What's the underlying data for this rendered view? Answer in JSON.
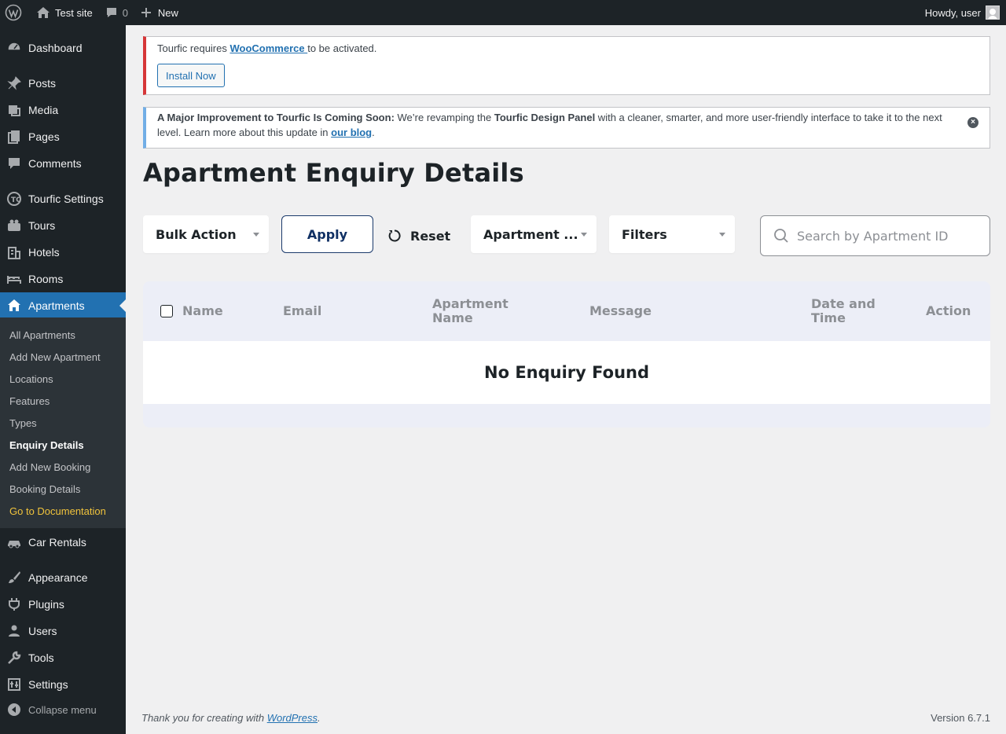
{
  "adminbar": {
    "site_name": "Test site",
    "comments_count": "0",
    "new_label": "New",
    "howdy": "Howdy, user"
  },
  "sidebar": {
    "items": [
      {
        "label": "Dashboard",
        "icon": "dashboard-icon"
      },
      {
        "label": "Posts",
        "icon": "pin-icon"
      },
      {
        "label": "Media",
        "icon": "media-icon"
      },
      {
        "label": "Pages",
        "icon": "pages-icon"
      },
      {
        "label": "Comments",
        "icon": "comment-icon"
      },
      {
        "label": "Tourfic Settings",
        "icon": "tourfic-icon"
      },
      {
        "label": "Tours",
        "icon": "tours-icon"
      },
      {
        "label": "Hotels",
        "icon": "building-icon"
      },
      {
        "label": "Rooms",
        "icon": "bed-icon"
      },
      {
        "label": "Apartments",
        "icon": "home-icon"
      },
      {
        "label": "Car Rentals",
        "icon": "car-icon"
      },
      {
        "label": "Appearance",
        "icon": "brush-icon"
      },
      {
        "label": "Plugins",
        "icon": "plug-icon"
      },
      {
        "label": "Users",
        "icon": "user-icon"
      },
      {
        "label": "Tools",
        "icon": "wrench-icon"
      },
      {
        "label": "Settings",
        "icon": "settings-icon"
      }
    ],
    "submenu": [
      "All Apartments",
      "Add New Apartment",
      "Locations",
      "Features",
      "Types",
      "Enquiry Details",
      "Add New Booking",
      "Booking Details",
      "Go to Documentation"
    ],
    "collapse_label": "Collapse menu"
  },
  "notices": {
    "error": {
      "text_before": "Tourfic requires ",
      "link": "WooCommerce ",
      "text_after": "to be activated.",
      "button": "Install Now"
    },
    "info": {
      "bold1": "A Major Improvement to Tourfic Is Coming Soon:",
      "text1": " We’re revamping the ",
      "bold2": "Tourfic Design Panel",
      "text2": " with a cleaner, smarter, and more user-friendly interface to take it to the next level. Learn more about this update in ",
      "link": "our blog",
      "text3": "."
    }
  },
  "page": {
    "title": "Apartment Enquiry Details"
  },
  "toolbar": {
    "bulk_action": "Bulk Action",
    "apply": "Apply",
    "reset": "Reset",
    "apartment_filter": "Apartment ...",
    "filters": "Filters",
    "search_placeholder": "Search by Apartment ID"
  },
  "table": {
    "headers": {
      "name": "Name",
      "email": "Email",
      "apartment_name_1": "Apartment",
      "apartment_name_2": "Name",
      "message": "Message",
      "date_1": "Date and",
      "date_2": "Time",
      "action": "Action"
    },
    "empty": "No Enquiry Found"
  },
  "footer": {
    "thanks": "Thank you for creating with ",
    "link": "WordPress",
    "period": ".",
    "version": "Version 6.7.1"
  },
  "colors": {
    "admin_bar": "#1d2327",
    "accent": "#2271b1",
    "error": "#d63638",
    "info": "#72aee6",
    "doc_link": "#f0c33c"
  }
}
